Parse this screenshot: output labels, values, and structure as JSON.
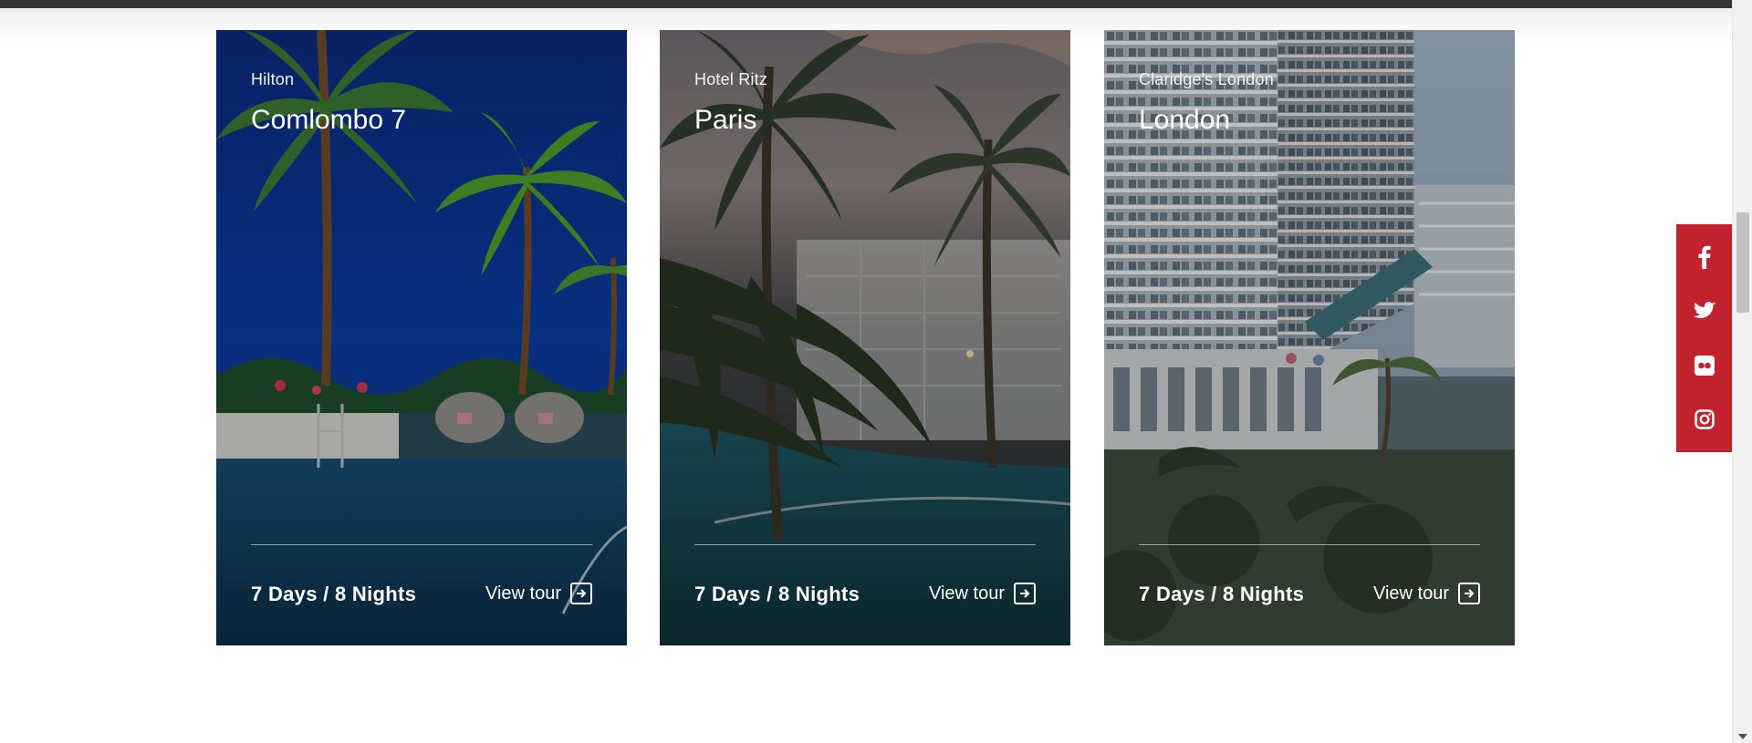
{
  "tours": [
    {
      "hotel": "Hilton",
      "city": "Comlombo 7",
      "duration": "7 Days / 8 Nights",
      "cta": "View tour"
    },
    {
      "hotel": "Hotel Ritz",
      "city": "Paris",
      "duration": "7 Days / 8 Nights",
      "cta": "View tour"
    },
    {
      "hotel": "Claridge's London",
      "city": "London",
      "duration": "7 Days / 8 Nights",
      "cta": "View tour"
    }
  ],
  "social": [
    "facebook-icon",
    "twitter-icon",
    "flickr-icon",
    "instagram-icon"
  ],
  "colors": {
    "social_bar": "#c0222e",
    "top_bar": "#363636"
  }
}
